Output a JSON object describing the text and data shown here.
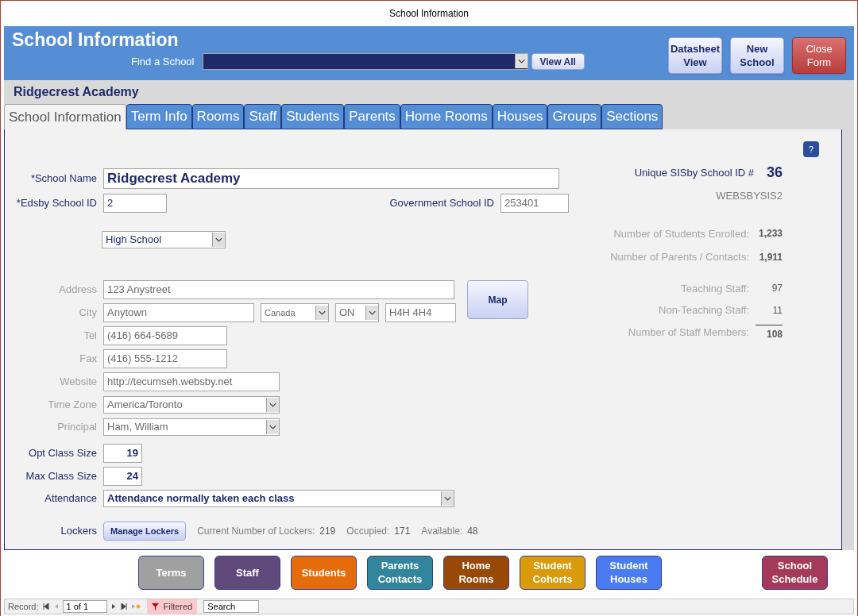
{
  "window": {
    "title": "School Information"
  },
  "header": {
    "title": "School Information",
    "find_label": "Find a School",
    "view_all": "View All",
    "buttons": [
      {
        "label": "Datasheet View",
        "kind": "normal"
      },
      {
        "label": "New School",
        "kind": "normal"
      },
      {
        "label": "Close Form",
        "kind": "danger"
      }
    ]
  },
  "record_title": "Ridgecrest Academy",
  "tabs": [
    {
      "label": "School Information",
      "selected": true
    },
    {
      "label": "Term Info",
      "selected": false
    },
    {
      "label": "Rooms",
      "selected": false
    },
    {
      "label": "Staff",
      "selected": false
    },
    {
      "label": "Students",
      "selected": false
    },
    {
      "label": "Parents",
      "selected": false
    },
    {
      "label": "Home Rooms",
      "selected": false
    },
    {
      "label": "Houses",
      "selected": false
    },
    {
      "label": "Groups",
      "selected": false
    },
    {
      "label": "Sections",
      "selected": false
    }
  ],
  "help": "?",
  "form": {
    "school_name": {
      "label": "*School Name",
      "value": "Ridgecrest Academy"
    },
    "edsby_id": {
      "label": "*Edsby School ID",
      "value": "2"
    },
    "government_id": {
      "label": "Government School ID",
      "value": "253401"
    },
    "school_type": {
      "value": "High School"
    },
    "address": {
      "label": "Address",
      "value": "123 Anystreet"
    },
    "city": {
      "label": "City",
      "value": "Anytown",
      "country": "Canada",
      "province": "ON",
      "postal": "H4H 4H4"
    },
    "map_button": "Map",
    "tel": {
      "label": "Tel",
      "value": "(416) 664-5689"
    },
    "fax": {
      "label": "Fax",
      "value": "(416) 555-1212"
    },
    "website": {
      "label": "Website",
      "value": "http://tecumseh.websby.net"
    },
    "time_zone": {
      "label": "Time Zone",
      "value": "America/Toronto"
    },
    "principal": {
      "label": "Principal",
      "value": "Ham, William"
    },
    "opt_class_size": {
      "label": "Opt Class Size",
      "value": "19"
    },
    "max_class_size": {
      "label": "Max Class Size",
      "value": "24"
    },
    "attendance": {
      "label": "Attendance",
      "value": "Attendance normally taken each class"
    },
    "lockers": {
      "label": "Lockers",
      "button": "Manage Lockers",
      "stats": [
        {
          "label": "Current Number of Lockers:",
          "value": "219"
        },
        {
          "label": "Occupied:",
          "value": "171"
        },
        {
          "label": "Available:",
          "value": "48"
        }
      ]
    }
  },
  "summary": {
    "unique_id_label": "Unique SISby School ID #",
    "unique_id": "36",
    "code": "WEBSBYSIS2",
    "counts": [
      {
        "label": "Number of Students Enrolled:",
        "value": "1,233",
        "kind": "bold"
      },
      {
        "label": "Number of Parents / Contacts:",
        "value": "1,911",
        "kind": "bold"
      }
    ],
    "staff": [
      {
        "label": "Teaching Staff:",
        "value": "97",
        "kind": "plain"
      },
      {
        "label": "Non-Teaching Staff:",
        "value": "11",
        "kind": "plain"
      },
      {
        "label": "Number of Staff Members:",
        "value": "108",
        "kind": "total"
      }
    ]
  },
  "nav_buttons": [
    {
      "label": "Terms",
      "color": "#a0a0a0"
    },
    {
      "label": "Staff",
      "color": "#604a7b"
    },
    {
      "label": "Students",
      "color": "#e46c0a"
    },
    {
      "label": "Parents Contacts",
      "color": "#31859c"
    },
    {
      "label": "Home Rooms",
      "color": "#984807"
    },
    {
      "label": "Student Cohorts",
      "color": "#d99b09"
    },
    {
      "label": "Student Houses",
      "color": "#4a7bf0"
    },
    {
      "label": "School Schedule",
      "color": "#a5395a"
    }
  ],
  "status_bar": {
    "record_label": "Record:",
    "position": "1 of 1",
    "filter": "Filtered",
    "search": "Search"
  }
}
